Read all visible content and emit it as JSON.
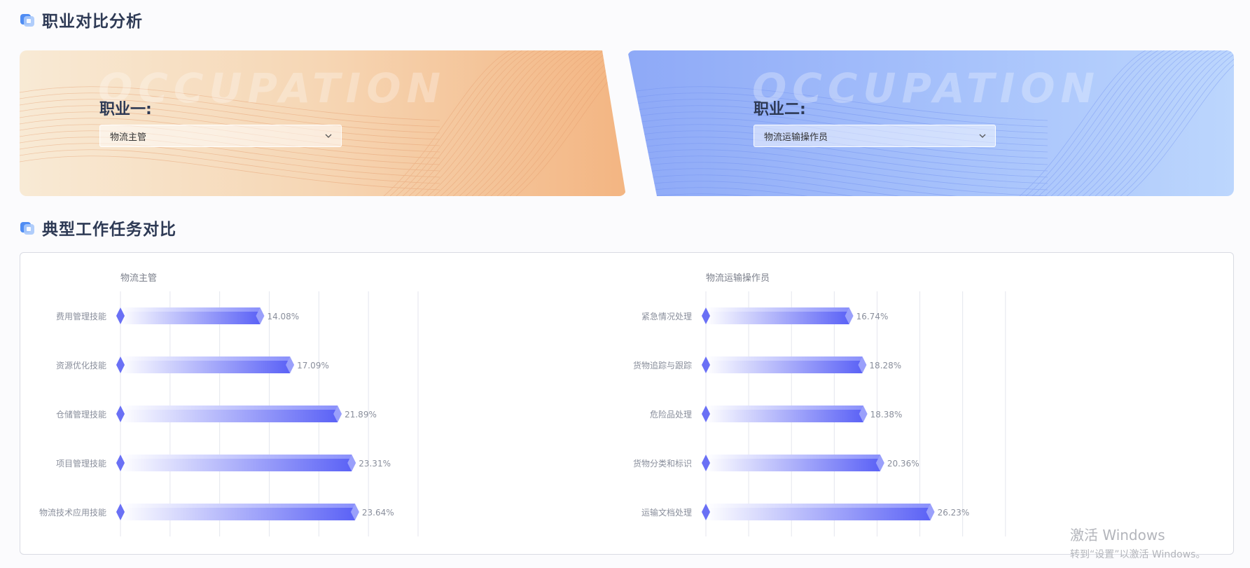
{
  "sections": {
    "occupation_title": "职业对比分析",
    "task_title": "典型工作任务对比"
  },
  "cards": {
    "watermark": "OCCUPATION",
    "left": {
      "label": "职业一:",
      "selected": "物流主管"
    },
    "right": {
      "label": "职业二:",
      "selected": "物流运输操作员"
    }
  },
  "colors": {
    "bar_start": "#ffffff",
    "bar_end": "#5b62f6",
    "bar_top": "#8a90fb",
    "diamond": "#6a70f5",
    "grid": "#e4e6ee",
    "label": "#8a8f9c"
  },
  "chart_data": [
    {
      "type": "bar",
      "orientation": "horizontal",
      "title": "物流主管",
      "categories": [
        "费用管理技能",
        "资源优化技能",
        "仓储管理技能",
        "项目管理技能",
        "物流技术应用技能"
      ],
      "values": [
        14.08,
        17.09,
        21.89,
        23.31,
        23.64
      ],
      "value_labels": [
        "14.08%",
        "17.09%",
        "21.89%",
        "23.31%",
        "23.64%"
      ],
      "xlim": [
        0,
        30
      ],
      "grid": true
    },
    {
      "type": "bar",
      "orientation": "horizontal",
      "title": "物流运输操作员",
      "categories": [
        "紧急情况处理",
        "货物追踪与跟踪",
        "危险品处理",
        "货物分类和标识",
        "运输文档处理"
      ],
      "values": [
        16.74,
        18.28,
        18.38,
        20.36,
        26.23
      ],
      "value_labels": [
        "16.74%",
        "18.28%",
        "18.38%",
        "20.36%",
        "26.23%"
      ],
      "xlim": [
        0,
        36
      ],
      "grid": true
    }
  ],
  "os_watermark": {
    "line1": "激活 Windows",
    "line2": "转到“设置”以激活 Windows。"
  }
}
